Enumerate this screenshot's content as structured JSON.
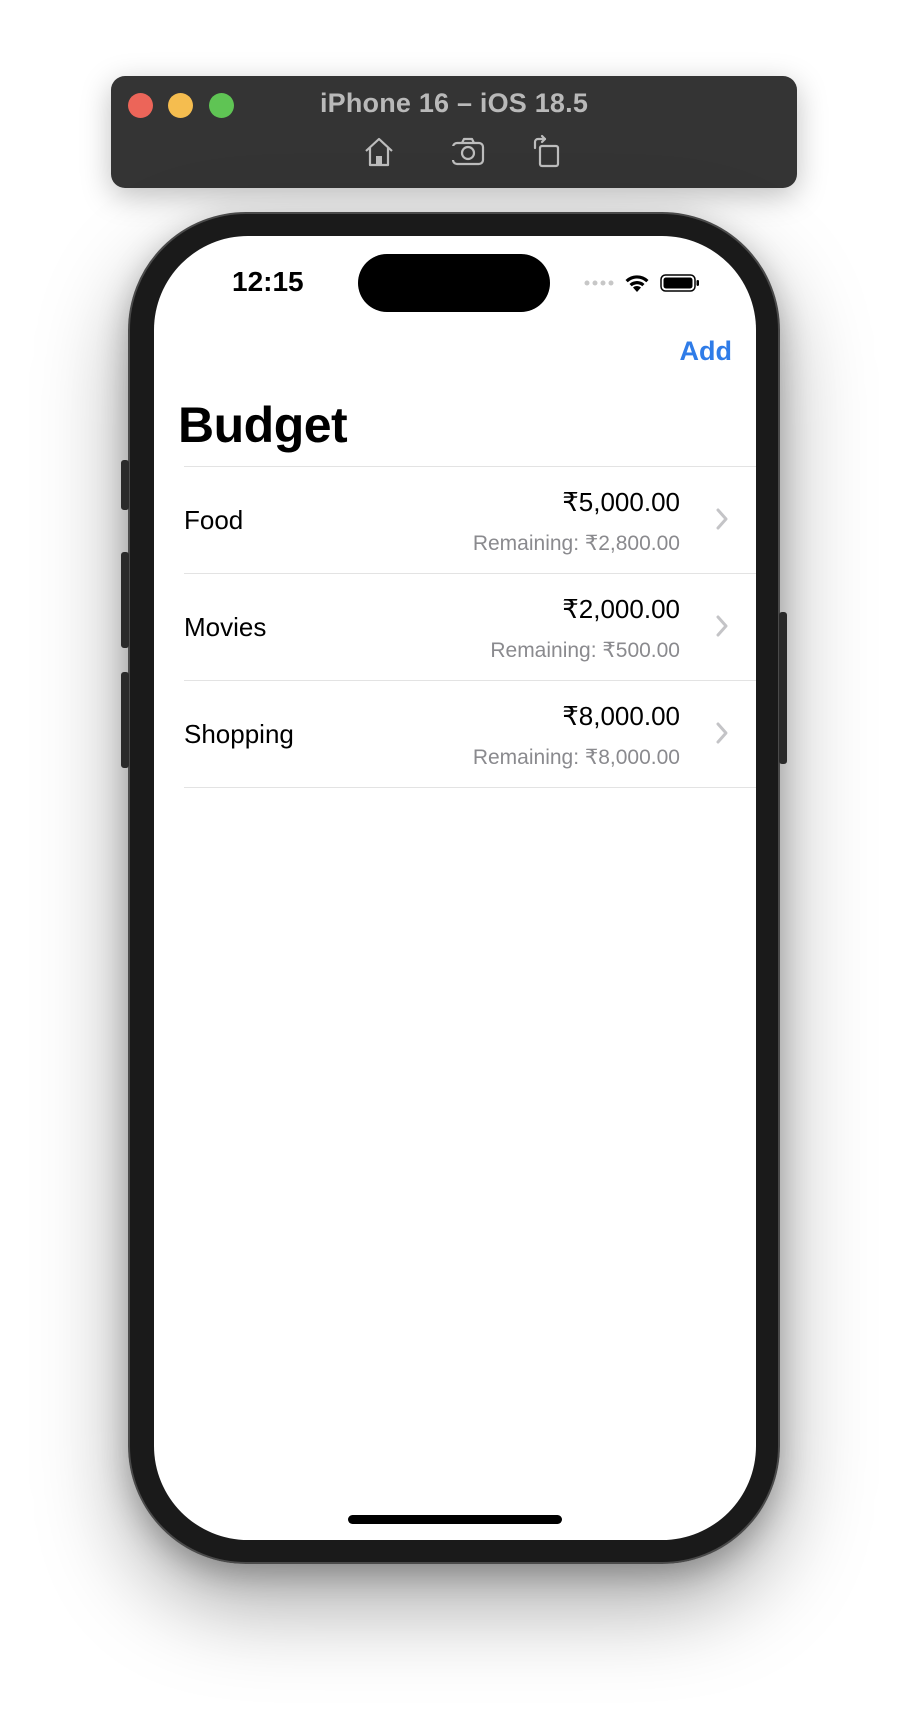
{
  "window": {
    "title": "iPhone 16 – iOS 18.5",
    "toolbar_icons": [
      "home-icon",
      "screenshot-icon",
      "rotate-icon"
    ]
  },
  "status_bar": {
    "time": "12:15",
    "icons": [
      "signal-icon",
      "wifi-icon",
      "battery-icon"
    ]
  },
  "nav": {
    "add_label": "Add",
    "title": "Budget"
  },
  "budgets": [
    {
      "name": "Food",
      "amount": "₹5,000.00",
      "remaining": "Remaining: ₹2,800.00"
    },
    {
      "name": "Movies",
      "amount": "₹2,000.00",
      "remaining": "Remaining: ₹500.00"
    },
    {
      "name": "Shopping",
      "amount": "₹8,000.00",
      "remaining": "Remaining: ₹8,000.00"
    }
  ],
  "colors": {
    "accent": "#2f7ce8",
    "secondary_text": "#8a8a8e",
    "separator": "#e3e3e3"
  }
}
